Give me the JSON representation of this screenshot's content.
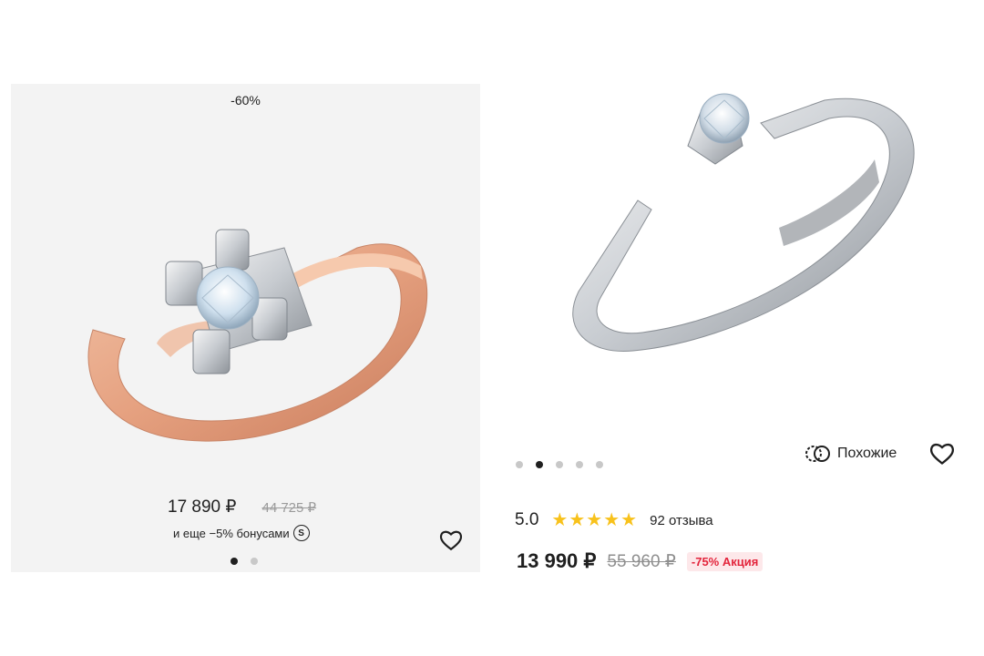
{
  "left_card": {
    "discount_label": "-60%",
    "price": "17 890 ₽",
    "old_price": "44 725 ₽",
    "bonus_text": "и еще −5% бонусами",
    "bonus_icon_letter": "S",
    "gallery_total": 2,
    "gallery_active": 1
  },
  "right_card": {
    "similar_label": "Похожие",
    "rating": "5.0",
    "stars": 5,
    "reviews": "92 отзыва",
    "price": "13 990 ₽",
    "old_price": "55 960 ₽",
    "promo": "-75% Акция",
    "gallery_total": 5,
    "gallery_active": 2
  },
  "colors": {
    "star": "#f8c21c",
    "promo_text": "#e3243b",
    "promo_bg": "#fde8ea",
    "rose_gold": "#e9a98a",
    "white_gold": "#d7dbe0"
  },
  "icons": [
    "heart-icon",
    "similar-icon",
    "star-icon",
    "bonus-icon"
  ]
}
